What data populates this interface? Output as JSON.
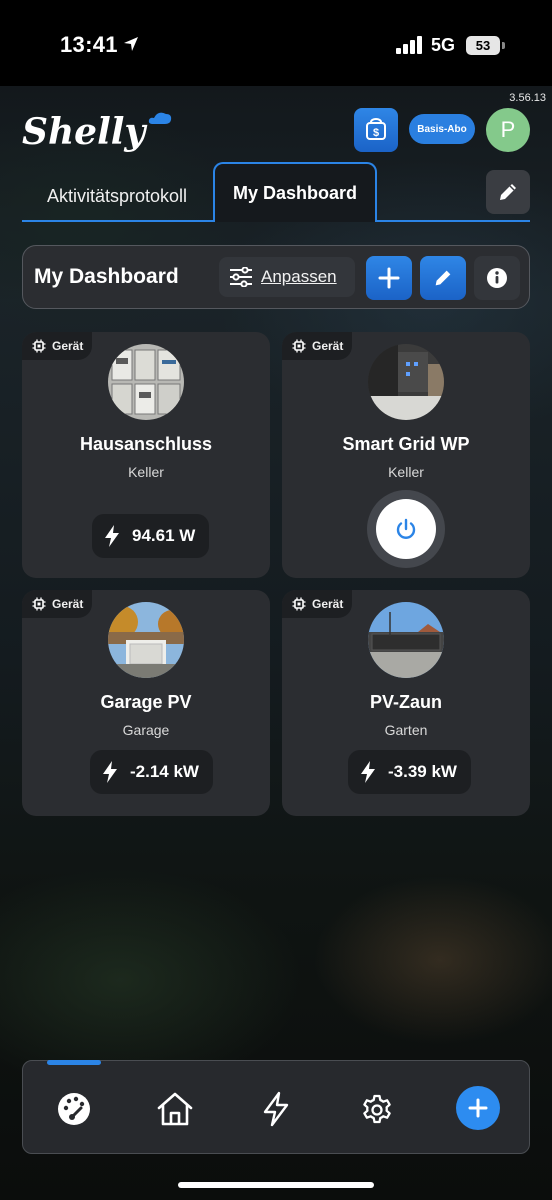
{
  "status_bar": {
    "time": "13:41",
    "network": "5G",
    "battery": "53"
  },
  "app": {
    "version": "3.56.13",
    "logo_text": "Shelly"
  },
  "topbar": {
    "subscription_label": "Basis-Abo",
    "avatar_initial": "P"
  },
  "tabs": [
    {
      "label": "Aktivitätsprotokoll",
      "active": false
    },
    {
      "label": "My Dashboard",
      "active": true
    }
  ],
  "dashboard": {
    "title": "My Dashboard",
    "customize_label": "Anpassen"
  },
  "devices": [
    {
      "badge": "Gerät",
      "name": "Hausanschluss",
      "room": "Keller",
      "power": "94.61 W",
      "kind": "meter"
    },
    {
      "badge": "Gerät",
      "name": "Smart Grid WP",
      "room": "Keller",
      "kind": "switch"
    },
    {
      "badge": "Gerät",
      "name": "Garage PV",
      "room": "Garage",
      "power": "-2.14 kW",
      "kind": "meter"
    },
    {
      "badge": "Gerät",
      "name": "PV-Zaun",
      "room": "Garten",
      "power": "-3.39 kW",
      "kind": "meter"
    }
  ],
  "bottom_nav": {
    "items": [
      "dashboard-icon",
      "home-icon",
      "energy-icon",
      "settings-icon",
      "add-icon"
    ],
    "active": "dashboard-icon"
  },
  "colors": {
    "accent": "#2b84e6",
    "card": "#2b2d31",
    "avatar": "#84c98b"
  }
}
